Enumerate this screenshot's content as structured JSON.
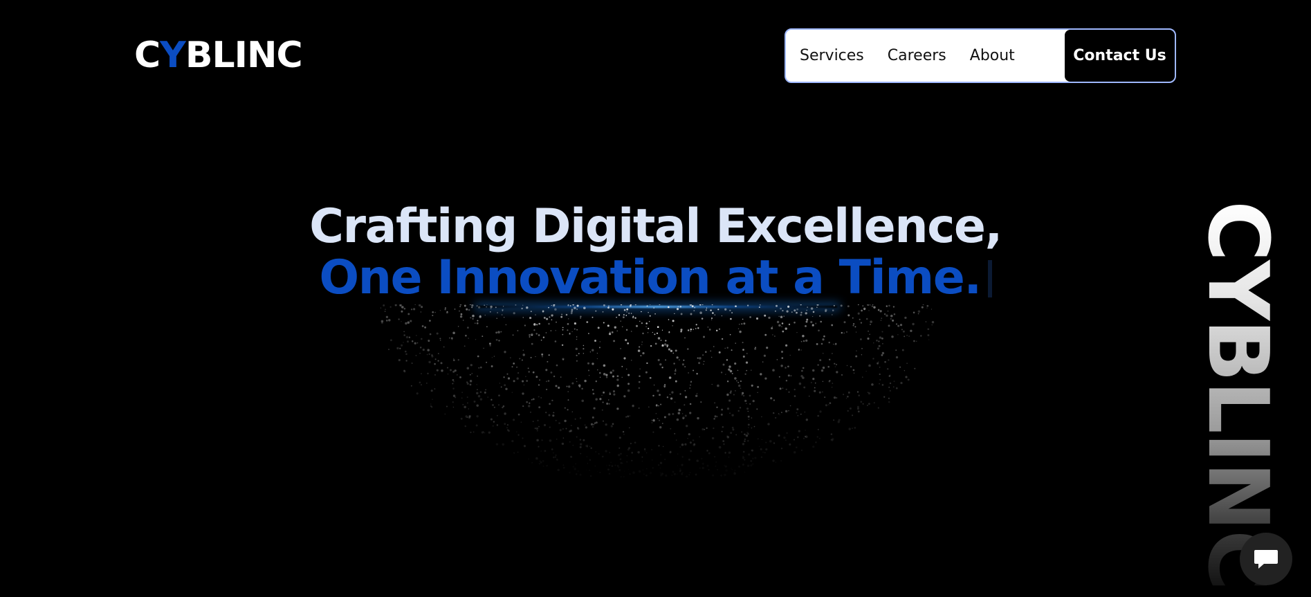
{
  "logo": {
    "prefix": "C",
    "accent": "Y",
    "suffix": "BLINC"
  },
  "nav": {
    "items": [
      {
        "label": "Services"
      },
      {
        "label": "Careers"
      },
      {
        "label": "About"
      }
    ],
    "contact_label": "Contact Us"
  },
  "hero": {
    "line1": "Crafting Digital Excellence,",
    "line2": "One Innovation at a Time."
  },
  "side_brand": "CYBLINC",
  "chat": {
    "icon": "chat-bubble-icon"
  },
  "colors": {
    "background": "#000000",
    "accent_blue": "#0b4dc2",
    "hero_text": "#dbe5f7",
    "nav_background": "#ffffff",
    "nav_border": "#9fb8ff",
    "contact_button": "#000000",
    "chat_button": "#222222"
  }
}
